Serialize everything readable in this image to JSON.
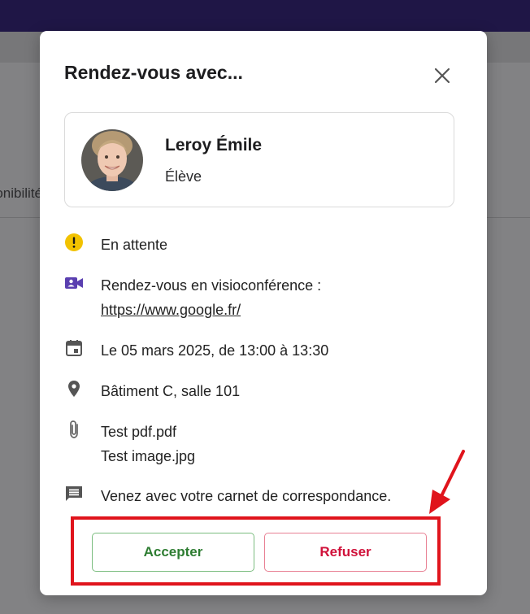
{
  "background": {
    "partial_text": "onibilité"
  },
  "modal": {
    "title": "Rendez-vous avec...",
    "close_icon": "close-icon",
    "student": {
      "name": "Leroy Émile",
      "role": "Élève"
    },
    "status": {
      "icon": "warning-icon",
      "text": "En attente",
      "color": "#f2c200"
    },
    "video": {
      "icon": "videocam-icon",
      "text": "Rendez-vous en visioconférence :",
      "link": "https://www.google.fr/",
      "color": "#5a3fb0"
    },
    "date": {
      "icon": "calendar-icon",
      "text": "Le 05 mars 2025, de 13:00 à 13:30"
    },
    "location": {
      "icon": "location-pin-icon",
      "text": "Bâtiment C, salle 101"
    },
    "attachments": {
      "icon": "paperclip-icon",
      "files": [
        "Test pdf.pdf",
        "Test image.jpg"
      ]
    },
    "comment": {
      "icon": "comment-icon",
      "text": "Venez avec votre carnet de correspondance."
    },
    "buttons": {
      "accept": "Accepter",
      "refuse": "Refuser"
    }
  },
  "annotation": {
    "highlight_color": "#e0141c"
  }
}
